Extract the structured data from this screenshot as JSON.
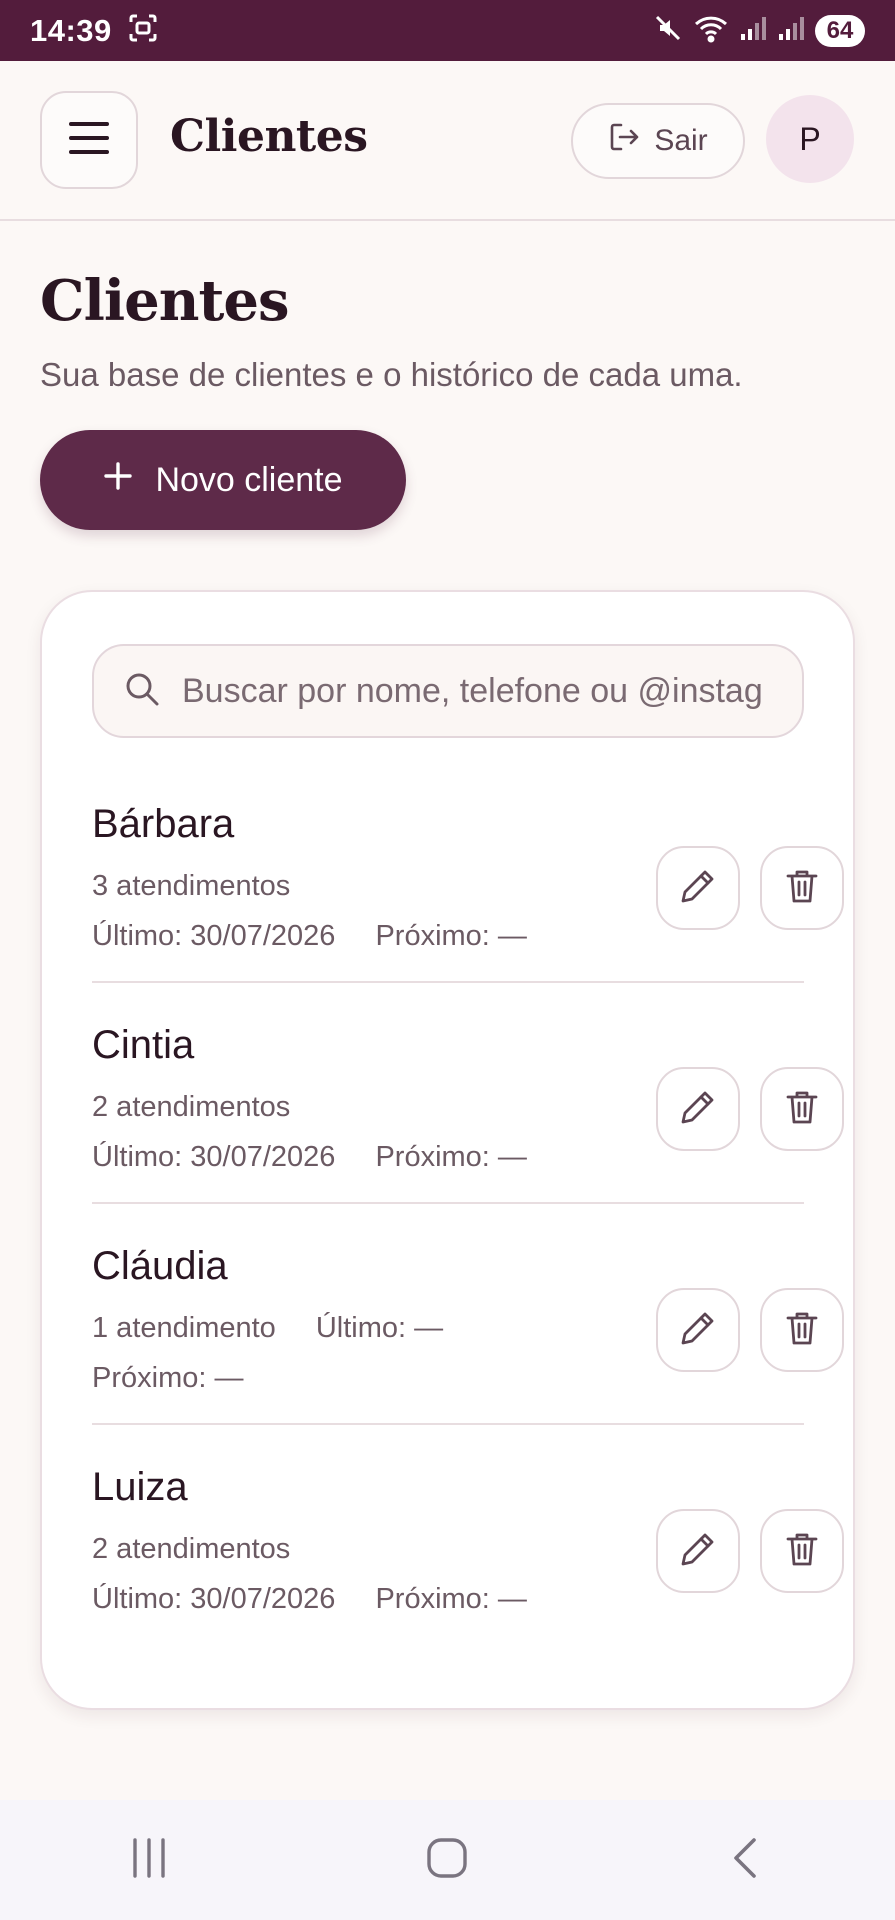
{
  "status_bar": {
    "time": "14:39",
    "battery": "64",
    "icons": [
      "screenshot-icon",
      "mute-icon",
      "wifi-icon",
      "signal-icon",
      "signal-icon"
    ]
  },
  "app_bar": {
    "title": "Clientes",
    "logout_label": "Sair",
    "avatar_initial": "P"
  },
  "page": {
    "title": "Clientes",
    "subtitle": "Sua base de clientes e o histórico de cada uma.",
    "new_client_label": "Novo cliente"
  },
  "search": {
    "placeholder": "Buscar por nome, telefone ou @instagram",
    "value": ""
  },
  "clients": [
    {
      "name": "Bárbara",
      "appointments": "3 atendimentos",
      "last": "Último: 30/07/2026",
      "next": "Próximo: —"
    },
    {
      "name": "Cintia",
      "appointments": "2 atendimentos",
      "last": "Último: 30/07/2026",
      "next": "Próximo: —"
    },
    {
      "name": "Cláudia",
      "appointments": "1 atendimento",
      "last": "Último: —",
      "next": "Próximo: —"
    },
    {
      "name": "Luiza",
      "appointments": "2 atendimentos",
      "last": "Último: 30/07/2026",
      "next": "Próximo: —"
    }
  ],
  "colors": {
    "primary": "#5e2a49",
    "status_bar": "#531c3c",
    "background": "#fcf8f6",
    "avatar_bg": "#f3e3ec"
  }
}
